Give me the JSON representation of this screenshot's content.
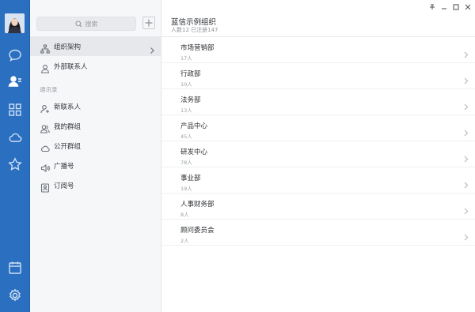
{
  "sidebar": {
    "icons": [
      "chat-bubble-icon",
      "contacts-icon",
      "apps-grid-icon",
      "cloud-icon",
      "star-icon",
      "calendar-icon",
      "settings-gear-icon"
    ]
  },
  "contacts_panel": {
    "search_placeholder": "搜索",
    "nav_items": [
      {
        "label": "组织架构",
        "icon": "org-chart-icon",
        "selected": true
      },
      {
        "label": "外部联系人",
        "icon": "person-outline-icon"
      }
    ],
    "section_label": "通讯录",
    "address_book": [
      {
        "label": "新联系人",
        "icon": "add-person-icon"
      },
      {
        "label": "我的群组",
        "icon": "group-icon"
      },
      {
        "label": "公开群组",
        "icon": "cloud-group-icon"
      },
      {
        "label": "广播号",
        "icon": "speaker-icon"
      },
      {
        "label": "订阅号",
        "icon": "subscription-icon"
      }
    ]
  },
  "main": {
    "org_name": "蓝信示例组织",
    "org_stats": "人数12 已注册147",
    "departments": [
      {
        "name": "市场营销部",
        "count": "17人"
      },
      {
        "name": "行政部",
        "count": "10人"
      },
      {
        "name": "法务部",
        "count": "13人"
      },
      {
        "name": "产品中心",
        "count": "45人"
      },
      {
        "name": "研发中心",
        "count": "78人"
      },
      {
        "name": "事业部",
        "count": "19人"
      },
      {
        "name": "人事财务部",
        "count": "8人"
      },
      {
        "name": "顾问委员会",
        "count": "2人"
      }
    ]
  },
  "colors": {
    "rail": "#2b6fc0",
    "panel": "#f6f7f9",
    "selected": "#e6e8ec"
  }
}
